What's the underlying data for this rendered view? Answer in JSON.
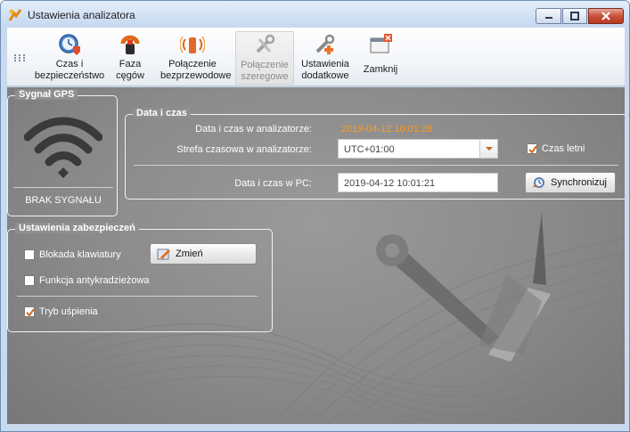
{
  "window": {
    "title": "Ustawienia analizatora",
    "controls": {
      "minimize": "minimize",
      "maximize": "maximize",
      "close": "close"
    }
  },
  "toolbar": {
    "items": [
      {
        "label": "Czas i\nbezpieczeństwo",
        "icon": "clock-shield-icon",
        "enabled": true
      },
      {
        "label": "Faza\ncęgów",
        "icon": "clamp-phase-icon",
        "enabled": true
      },
      {
        "label": "Połączenie\nbezprzewodowe",
        "icon": "wireless-icon",
        "enabled": true
      },
      {
        "label": "Połączenie\nszeregowe",
        "icon": "serial-tools-icon",
        "enabled": false
      },
      {
        "label": "Ustawienia\ndodatkowe",
        "icon": "extra-settings-icon",
        "enabled": true
      },
      {
        "label": "Zamknij",
        "icon": "close-window-icon",
        "enabled": true
      }
    ]
  },
  "gps": {
    "title": "Sygnał GPS",
    "status": "BRAK SYGNAŁU",
    "icon": "gps-signal-icon"
  },
  "datetime": {
    "title": "Data i czas",
    "analyzer_label": "Data i czas w analizatorze:",
    "analyzer_value": "2019-04-12 10:01:28",
    "timezone_label": "Strefa czasowa w analizatorze:",
    "timezone_value": "UTC+01:00",
    "summer_time_label": "Czas letni",
    "summer_time_checked": true,
    "pc_label": "Data i czas w PC:",
    "pc_value": "2019-04-12 10:01:21",
    "sync_button": "Synchronizuj"
  },
  "security": {
    "title": "Ustawienia zabezpieczeń",
    "keyboard_lock_label": "Blokada klawiatury",
    "keyboard_lock_checked": false,
    "change_button": "Zmień",
    "antitheft_label": "Funkcja antykradzieżowa",
    "antitheft_checked": false,
    "sleep_label": "Tryb uśpienia",
    "sleep_checked": true
  },
  "colors": {
    "accent_value": "#ff9a1f",
    "panel_bg": "#8f8f8f",
    "check_mark": "#d26a1a"
  }
}
